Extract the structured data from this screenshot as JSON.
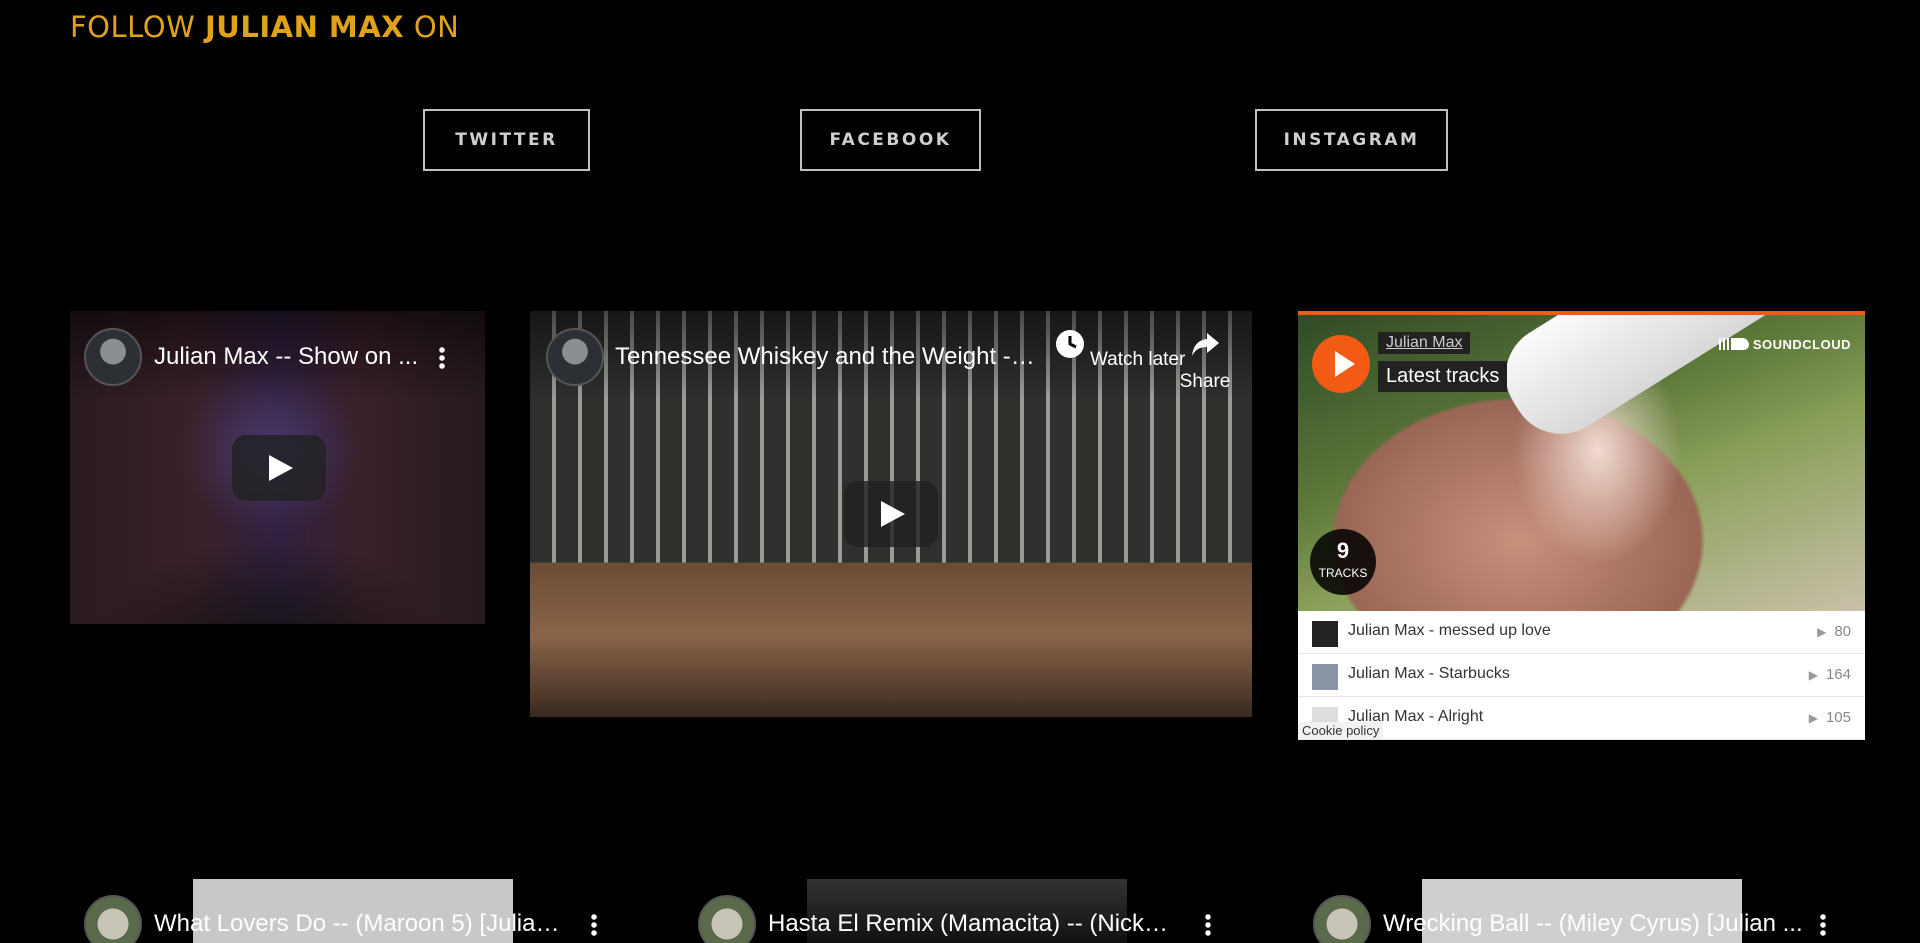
{
  "follow": {
    "prefix": "FOLLOW ",
    "name": "JULIAN MAX",
    "suffix": " ON"
  },
  "social": {
    "twitter": "TWITTER",
    "facebook": "FACEBOOK",
    "instagram": "INSTAGRAM"
  },
  "videos": [
    {
      "title": "Julian Max -- Show on ..."
    },
    {
      "title": "Tennessee Whiskey and the Weight --...",
      "watch_later": "Watch later",
      "share": "Share"
    },
    {
      "title": "What Lovers Do -- (Maroon 5) [Julian..."
    },
    {
      "title": "Hasta El Remix (Mamacita) -- (Nicky ..."
    },
    {
      "title": "Wrecking Ball -- (Miley Cyrus) [Julian ..."
    }
  ],
  "soundcloud": {
    "user": "Julian Max",
    "label": "Latest tracks",
    "brand": "SOUNDCLOUD",
    "count": "9",
    "count_label": "TRACKS",
    "tracks": [
      {
        "title": "Julian Max - messed up love",
        "plays": "80"
      },
      {
        "title": "Julian Max - Starbucks",
        "plays": "164"
      },
      {
        "title": "Julian Max - Alright",
        "plays": "105"
      }
    ],
    "cookie": "Cookie policy"
  },
  "colors": {
    "accent": "#e0a11b",
    "soundcloud": "#f35a14"
  }
}
